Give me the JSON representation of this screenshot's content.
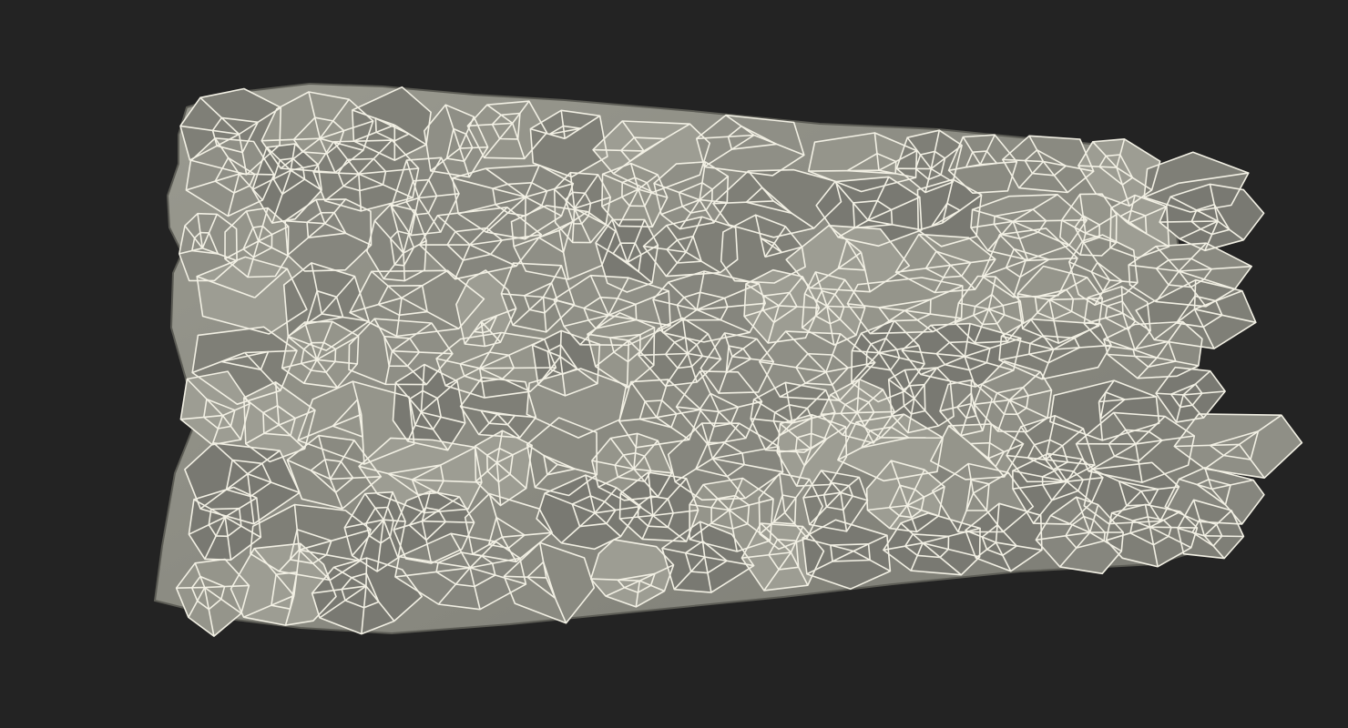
{
  "scene": {
    "background_color": "#232323",
    "model_fill_color": "#8f8f86",
    "model_shade_color": "#6b6b64",
    "model_highlight_color": "#a7a79d",
    "wireframe_color": "#f2f0e4",
    "subject": "stone-wall-wireframe-model"
  }
}
